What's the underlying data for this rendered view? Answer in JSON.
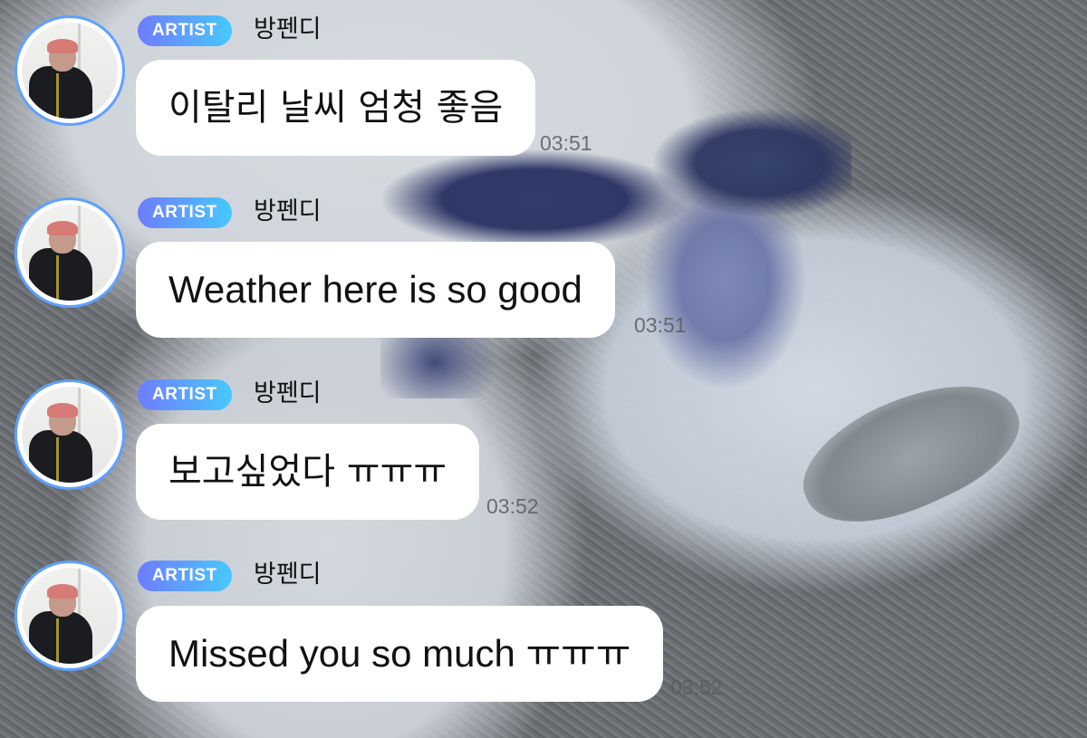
{
  "messages": [
    {
      "badge": "ARTIST",
      "author": "방펜디",
      "text": "이탈리 날씨 엄청 좋음",
      "time": "03:51"
    },
    {
      "badge": "ARTIST",
      "author": "방펜디",
      "text": "Weather here is so good",
      "time": "03:51"
    },
    {
      "badge": "ARTIST",
      "author": "방펜디",
      "text": "보고싶었다 ㅠㅠㅠ",
      "time": "03:52"
    },
    {
      "badge": "ARTIST",
      "author": "방펜디",
      "text": "Missed you so much ㅠㅠㅠ",
      "time": "03:52"
    }
  ],
  "colors": {
    "avatar_ring": "#5ea1ff",
    "badge_gradient_start": "#6d7cff",
    "badge_gradient_end": "#47c8ff",
    "bubble_bg": "#ffffff"
  }
}
